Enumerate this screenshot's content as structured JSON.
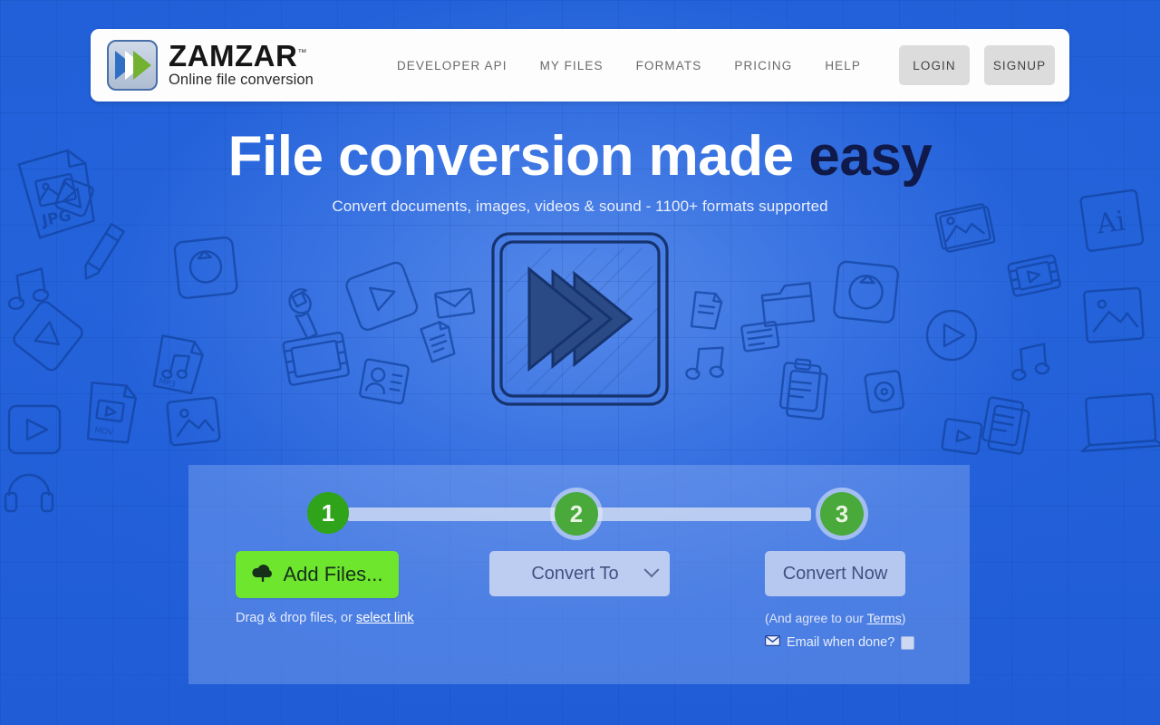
{
  "brand": {
    "name": "ZAMZAR",
    "trademark": "™",
    "tagline": "Online file conversion",
    "logo_icon": "double-chevron-logo-icon",
    "colors": {
      "page_blue": "#2160d8",
      "accent_green": "#6ee62e",
      "step_green": "#2fa319",
      "headline_dark": "#101a4a"
    }
  },
  "header": {
    "nav": [
      {
        "label": "DEVELOPER API"
      },
      {
        "label": "MY FILES"
      },
      {
        "label": "FORMATS"
      },
      {
        "label": "PRICING"
      },
      {
        "label": "HELP"
      }
    ],
    "login_label": "LOGIN",
    "signup_label": "SIGNUP"
  },
  "hero": {
    "title_main": "File conversion made",
    "title_accent": "easy",
    "subtitle": "Convert documents, images, videos & sound - 1100+ formats supported",
    "illustration_icon": "fast-forward-doodle-icon"
  },
  "converter": {
    "steps": [
      {
        "number": "1"
      },
      {
        "number": "2"
      },
      {
        "number": "3"
      }
    ],
    "add_files": {
      "label": "Add Files...",
      "icon": "cloud-upload-icon",
      "hint_prefix": "Drag & drop files, or ",
      "hint_link": "select link"
    },
    "convert_to": {
      "selected": "Convert To",
      "caret_icon": "chevron-down-icon"
    },
    "convert_now": {
      "label": "Convert Now",
      "terms_prefix": "(And agree to our ",
      "terms_link": "Terms",
      "terms_suffix": ")",
      "email_icon": "envelope-icon",
      "email_label": "Email when done?",
      "email_checked": false
    }
  }
}
